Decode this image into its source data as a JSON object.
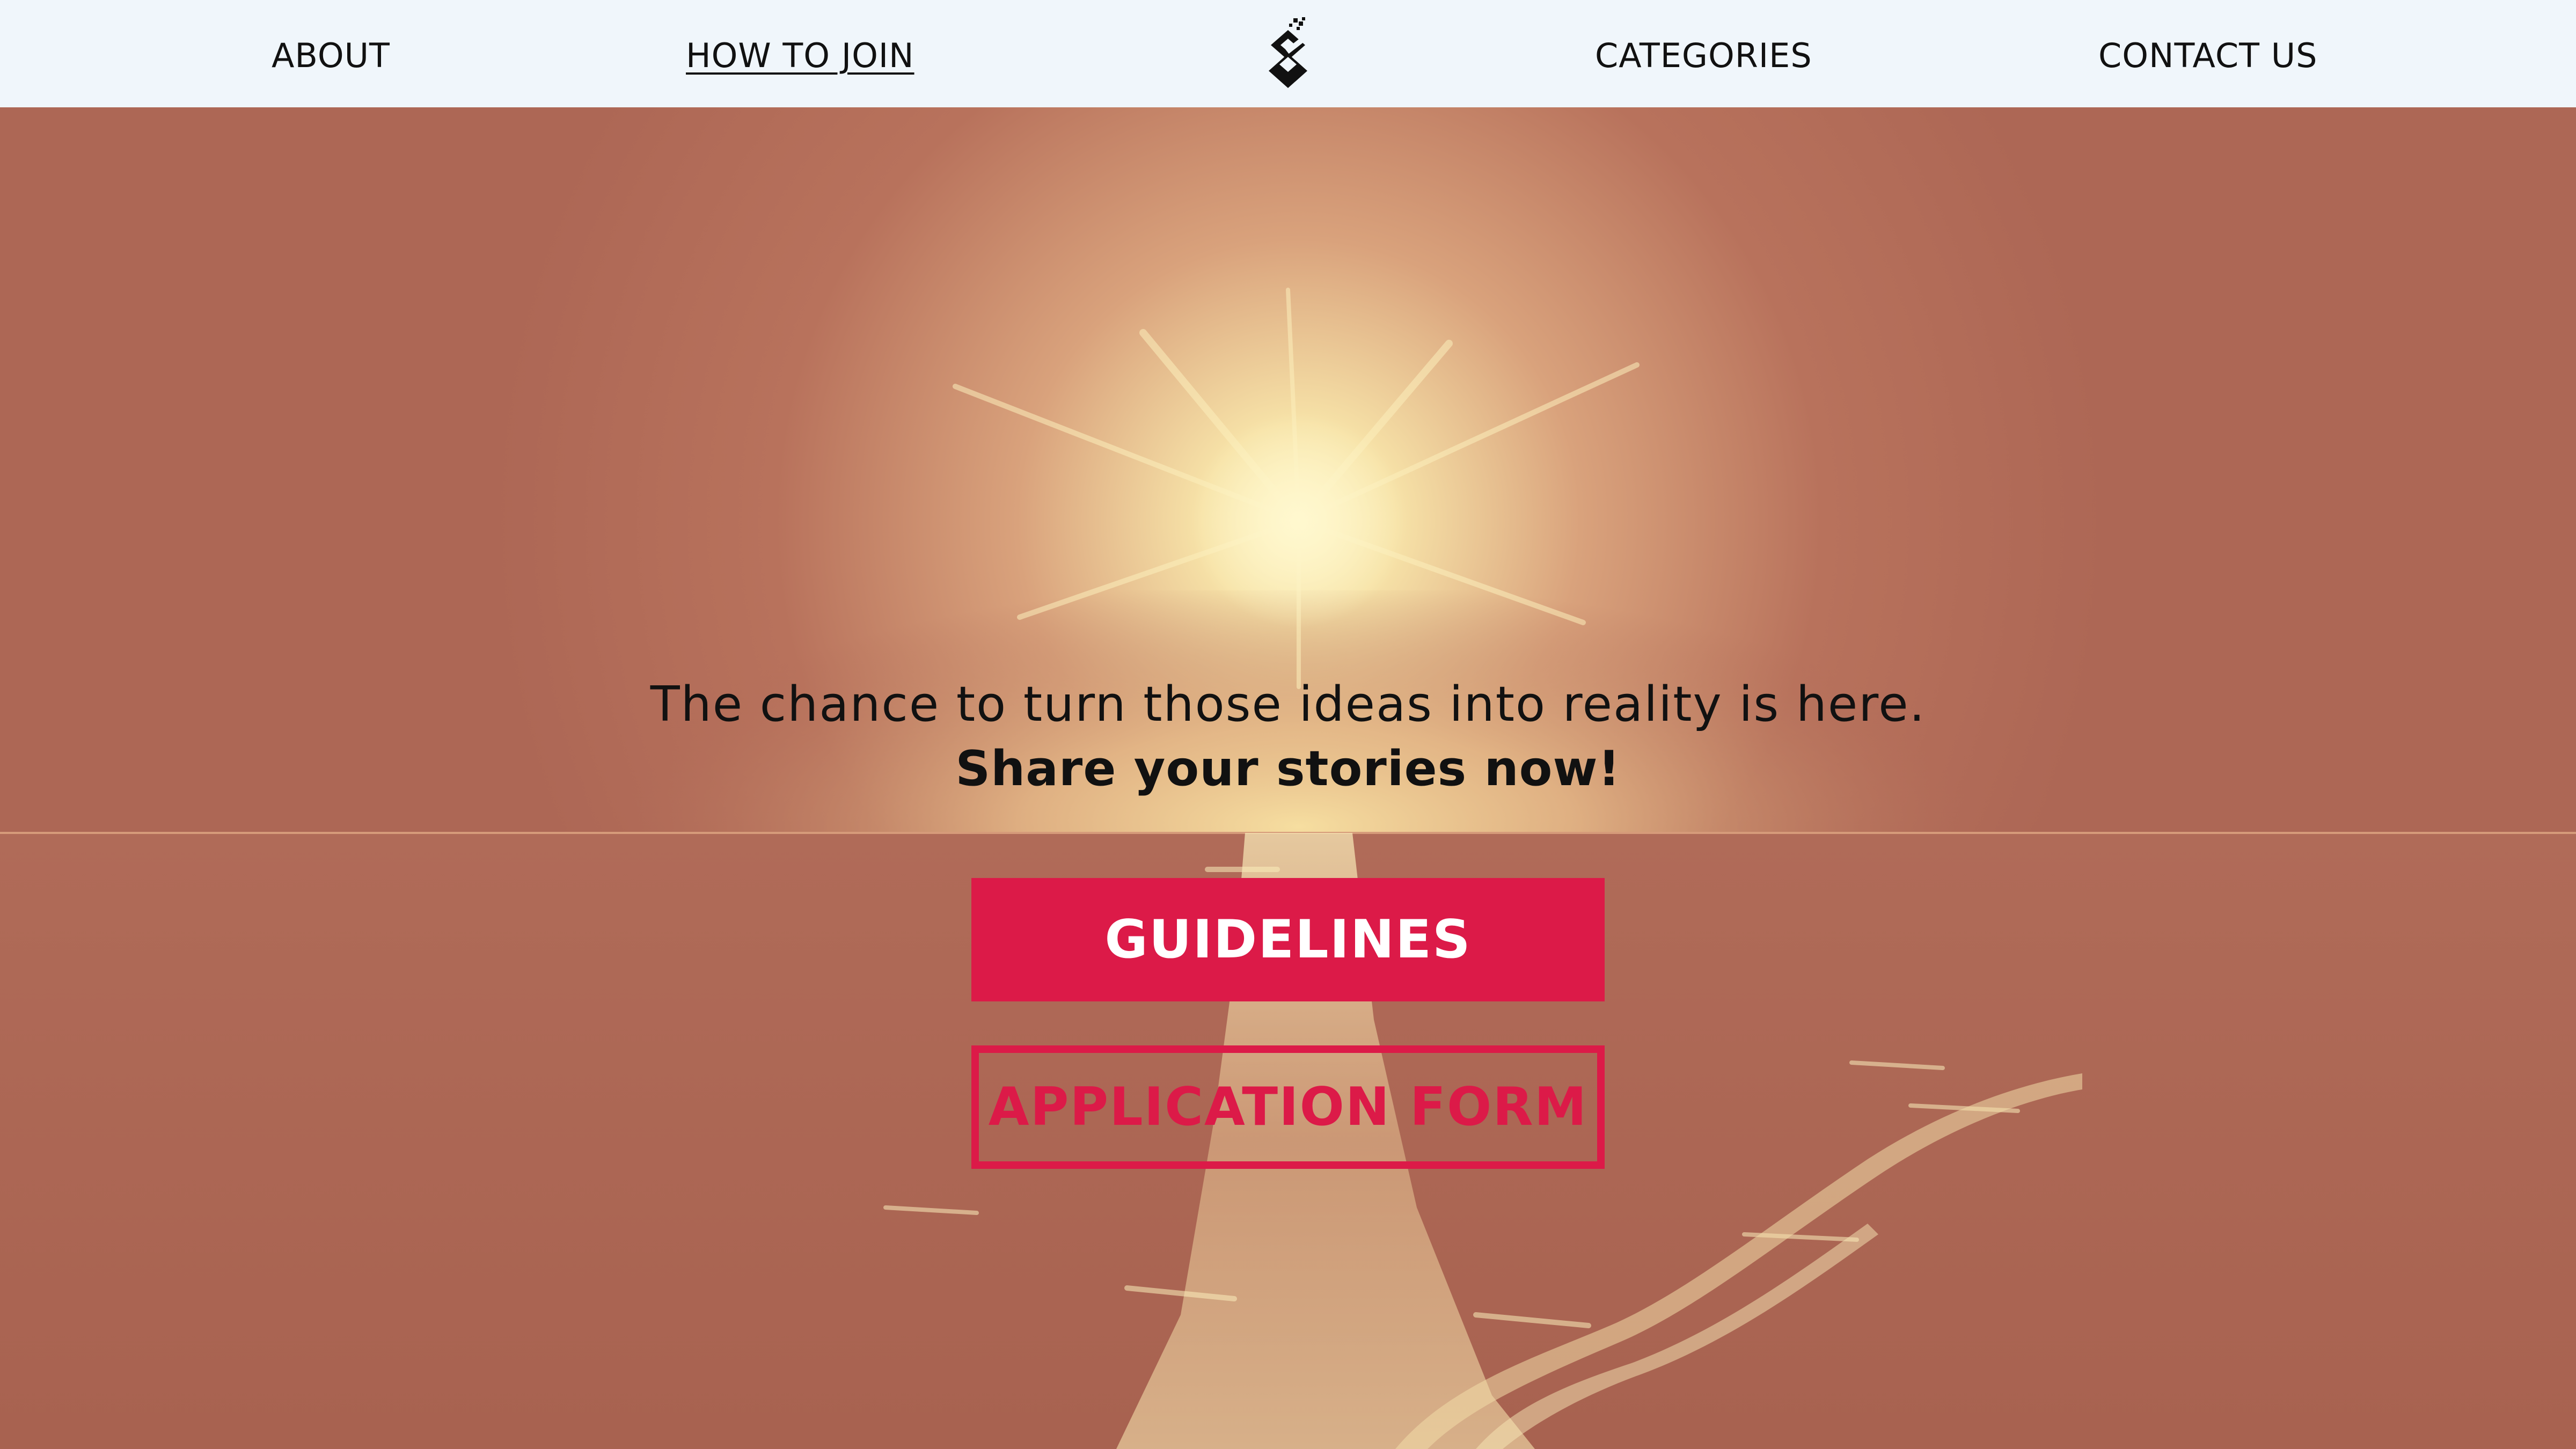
{
  "nav": {
    "items": [
      {
        "label": "ABOUT"
      },
      {
        "label": "HOW TO JOIN",
        "active": true
      },
      {
        "label": "CATEGORIES"
      },
      {
        "label": "CONTACT US"
      }
    ],
    "logo_icon": "diamond-s-logo-icon"
  },
  "hero": {
    "tagline": "The chance to turn those ideas into reality is here.",
    "cta_line": "Share your stories now!",
    "background": "sunset-over-sea-duotone"
  },
  "buttons": {
    "guidelines_label": "GUIDELINES",
    "application_label": "APPLICATION FORM"
  },
  "colors": {
    "nav_bg": "#f0f6fb",
    "accent": "#dc1a48",
    "duotone_dark": "#ad6755",
    "duotone_light": "#fbeebb",
    "text": "#111111"
  }
}
